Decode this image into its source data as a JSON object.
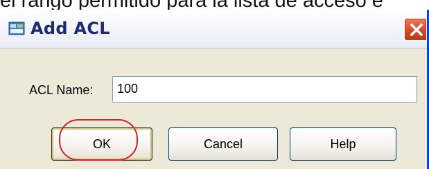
{
  "background_caption": "el rango permitido para la lista de acceso e",
  "dialog": {
    "title": "Add ACL",
    "title_icon": "acl-app-icon",
    "close_icon": "close-icon",
    "close_color": "#d24a27"
  },
  "form": {
    "name_label": "ACL Name:",
    "name_value": "100"
  },
  "buttons": {
    "ok": "OK",
    "cancel": "Cancel",
    "help": "Help"
  },
  "annotation": {
    "type": "red-circle-highlight",
    "target": "OK",
    "color": "#d42020"
  }
}
